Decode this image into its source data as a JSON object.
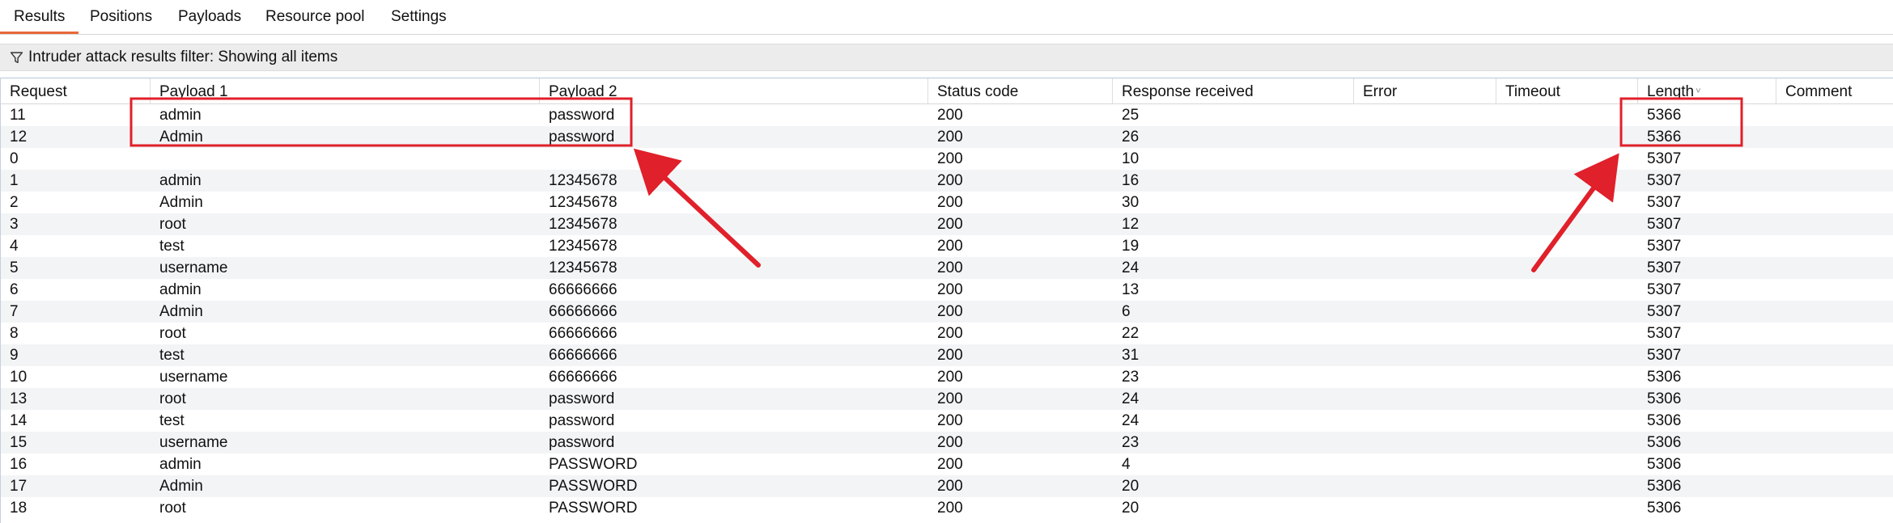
{
  "tabs": [
    {
      "label": "Results",
      "active": true
    },
    {
      "label": "Positions",
      "active": false
    },
    {
      "label": "Payloads",
      "active": false
    },
    {
      "label": "Resource pool",
      "active": false
    },
    {
      "label": "Settings",
      "active": false
    }
  ],
  "filter": {
    "icon": "funnel-icon",
    "text": "Intruder attack results filter: Showing all items"
  },
  "table": {
    "columns": [
      "Request",
      "Payload 1",
      "Payload 2",
      "Status code",
      "Response received",
      "Error",
      "Timeout",
      "Length",
      "Comment"
    ],
    "sorted_column": "Length",
    "rows": [
      [
        "11",
        "admin",
        "password",
        "200",
        "25",
        "",
        "",
        "5366",
        ""
      ],
      [
        "12",
        "Admin",
        "password",
        "200",
        "26",
        "",
        "",
        "5366",
        ""
      ],
      [
        "0",
        "",
        "",
        "200",
        "10",
        "",
        "",
        "5307",
        ""
      ],
      [
        "1",
        "admin",
        "12345678",
        "200",
        "16",
        "",
        "",
        "5307",
        ""
      ],
      [
        "2",
        "Admin",
        "12345678",
        "200",
        "30",
        "",
        "",
        "5307",
        ""
      ],
      [
        "3",
        "root",
        "12345678",
        "200",
        "12",
        "",
        "",
        "5307",
        ""
      ],
      [
        "4",
        "test",
        "12345678",
        "200",
        "19",
        "",
        "",
        "5307",
        ""
      ],
      [
        "5",
        "username",
        "12345678",
        "200",
        "24",
        "",
        "",
        "5307",
        ""
      ],
      [
        "6",
        "admin",
        "66666666",
        "200",
        "13",
        "",
        "",
        "5307",
        ""
      ],
      [
        "7",
        "Admin",
        "66666666",
        "200",
        "6",
        "",
        "",
        "5307",
        ""
      ],
      [
        "8",
        "root",
        "66666666",
        "200",
        "22",
        "",
        "",
        "5307",
        ""
      ],
      [
        "9",
        "test",
        "66666666",
        "200",
        "31",
        "",
        "",
        "5307",
        ""
      ],
      [
        "10",
        "username",
        "66666666",
        "200",
        "23",
        "",
        "",
        "5306",
        ""
      ],
      [
        "13",
        "root",
        "password",
        "200",
        "24",
        "",
        "",
        "5306",
        ""
      ],
      [
        "14",
        "test",
        "password",
        "200",
        "24",
        "",
        "",
        "5306",
        ""
      ],
      [
        "15",
        "username",
        "password",
        "200",
        "23",
        "",
        "",
        "5306",
        ""
      ],
      [
        "16",
        "admin",
        "PASSWORD",
        "200",
        "4",
        "",
        "",
        "5306",
        ""
      ],
      [
        "17",
        "Admin",
        "PASSWORD",
        "200",
        "20",
        "",
        "",
        "5306",
        ""
      ],
      [
        "18",
        "root",
        "PASSWORD",
        "200",
        "20",
        "",
        "",
        "5306",
        ""
      ]
    ]
  },
  "colors": {
    "annotation": "#e0202a",
    "active_tab_underline": "#e8683a",
    "row_alt": "#f3f4f6",
    "filter_bg": "#ececec"
  }
}
